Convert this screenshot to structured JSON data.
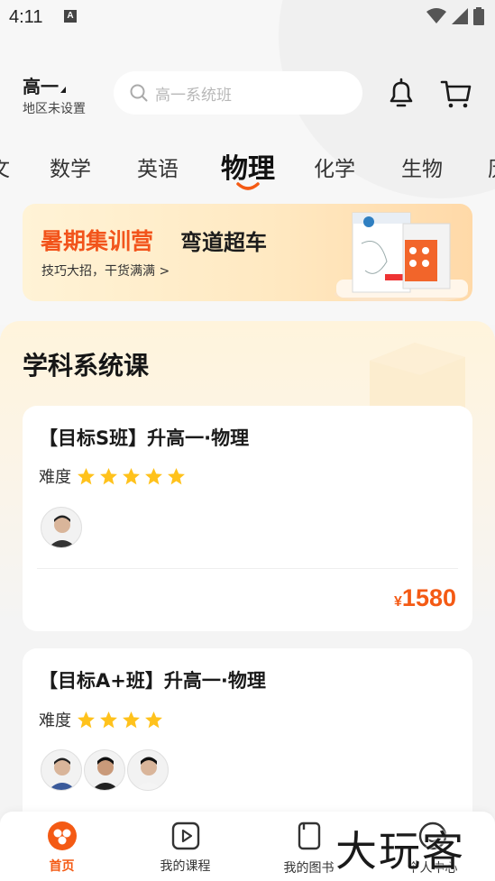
{
  "status_bar": {
    "time": "4:11",
    "notif_letter": "A"
  },
  "header": {
    "grade": "高一",
    "region": "地区未设置",
    "search_placeholder": "高一系统班"
  },
  "tabs": [
    {
      "label": "文"
    },
    {
      "label": "数学"
    },
    {
      "label": "英语"
    },
    {
      "label": "物理",
      "active": true
    },
    {
      "label": "化学"
    },
    {
      "label": "生物"
    },
    {
      "label": "历"
    }
  ],
  "banner": {
    "title": "暑期集训营",
    "subtitle": "弯道超车",
    "desc": "技巧大招，干货满满 >"
  },
  "section": {
    "title": "学科系统课"
  },
  "courses": [
    {
      "title": "【目标S班】升高一·物理",
      "difficulty_label": "难度",
      "stars": 5,
      "price_symbol": "¥",
      "price": "1580"
    },
    {
      "title": "【目标A+班】升高一·物理",
      "difficulty_label": "难度",
      "stars": 4
    }
  ],
  "nav": [
    {
      "label": "首页",
      "active": true
    },
    {
      "label": "我的课程"
    },
    {
      "label": "我的图书"
    },
    {
      "label": "个人中心"
    }
  ],
  "watermark": "大玩客",
  "colors": {
    "accent": "#f45a14",
    "star": "#ffc21c"
  }
}
